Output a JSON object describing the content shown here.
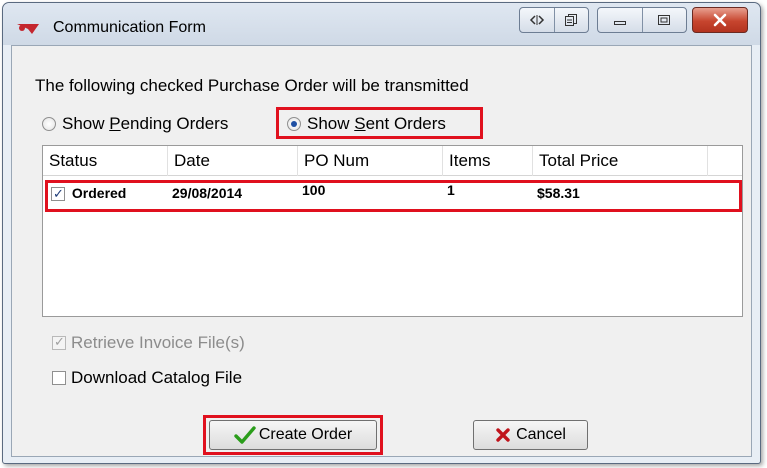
{
  "window": {
    "title": "Communication Form"
  },
  "form": {
    "caption": "The following checked Purchase Order will be transmitted",
    "radio_pending": {
      "label_pre": "Show ",
      "label_key": "P",
      "label_post": "ending Orders",
      "selected": false
    },
    "radio_sent": {
      "label_pre": "Show ",
      "label_key": "S",
      "label_post": "ent Orders",
      "selected": true
    }
  },
  "table": {
    "columns": [
      "Status",
      "Date",
      "PO Num",
      "Items",
      "Total Price"
    ],
    "rows": [
      {
        "status": "Ordered",
        "checked": true,
        "date": "29/08/2014",
        "po_num": "100",
        "items": "1",
        "total": "$58.31"
      }
    ]
  },
  "options": {
    "retrieve_invoice": {
      "label": "Retrieve Invoice File(s)",
      "checked": true,
      "enabled": false
    },
    "download_catalog": {
      "label": "Download Catalog File",
      "checked": false,
      "enabled": true
    }
  },
  "buttons": {
    "create_order": "Create Order",
    "cancel": "Cancel"
  },
  "colors": {
    "highlight": "#e0101e",
    "check_green": "#2a9d1a",
    "cancel_x": "#c0141c"
  }
}
